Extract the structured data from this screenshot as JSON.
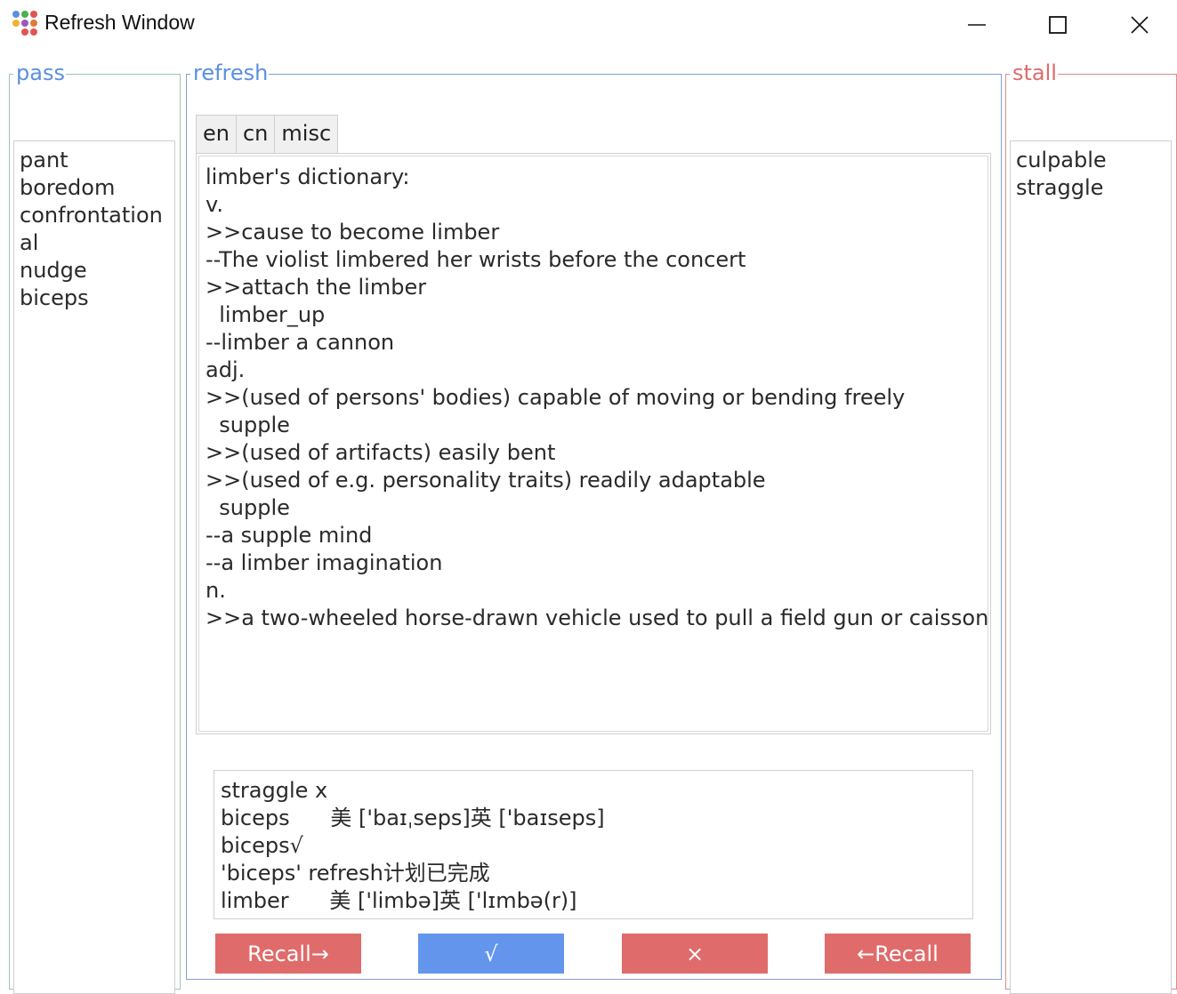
{
  "window": {
    "title": "Refresh Window",
    "colors": {
      "blue": "#6495ed",
      "red": "#e06b6b",
      "green_border": "#9ec6b1"
    }
  },
  "pass": {
    "label": "pass",
    "items": [
      "pant",
      "boredom",
      "confrontation",
      "al",
      "nudge",
      "biceps"
    ]
  },
  "refresh": {
    "label": "refresh",
    "tabs": [
      "en",
      "cn",
      "misc"
    ],
    "dictionary_text": "limber's dictionary:\nv.\n>>cause to become limber\n--The violist limbered her wrists before the concert\n>>attach the limber\n  limber_up\n--limber a cannon\nadj.\n>>(used of persons' bodies) capable of moving or bending freely\n  supple\n>>(used of artifacts) easily bent\n>>(used of e.g. personality traits) readily adaptable\n  supple\n--a supple mind\n--a limber imagination\nn.\n>>a two-wheeled horse-drawn vehicle used to pull a field gun or caisson",
    "log_text": "straggle x\nbiceps      美 ['baɪˌseps]英 ['baɪseps]\nbiceps√\n'biceps' refresh计划已完成\nlimber      美 ['limbə]英 ['lɪmbə(r)]"
  },
  "stall": {
    "label": "stall",
    "items": [
      "culpable",
      "straggle"
    ]
  },
  "buttons": {
    "recall_right": "Recall→",
    "check": "√",
    "cross": "×",
    "recall_left": "←Recall"
  },
  "icons": {
    "app": "app-dots-icon",
    "minimize": "minimize-icon",
    "maximize": "maximize-icon",
    "close": "close-icon"
  }
}
